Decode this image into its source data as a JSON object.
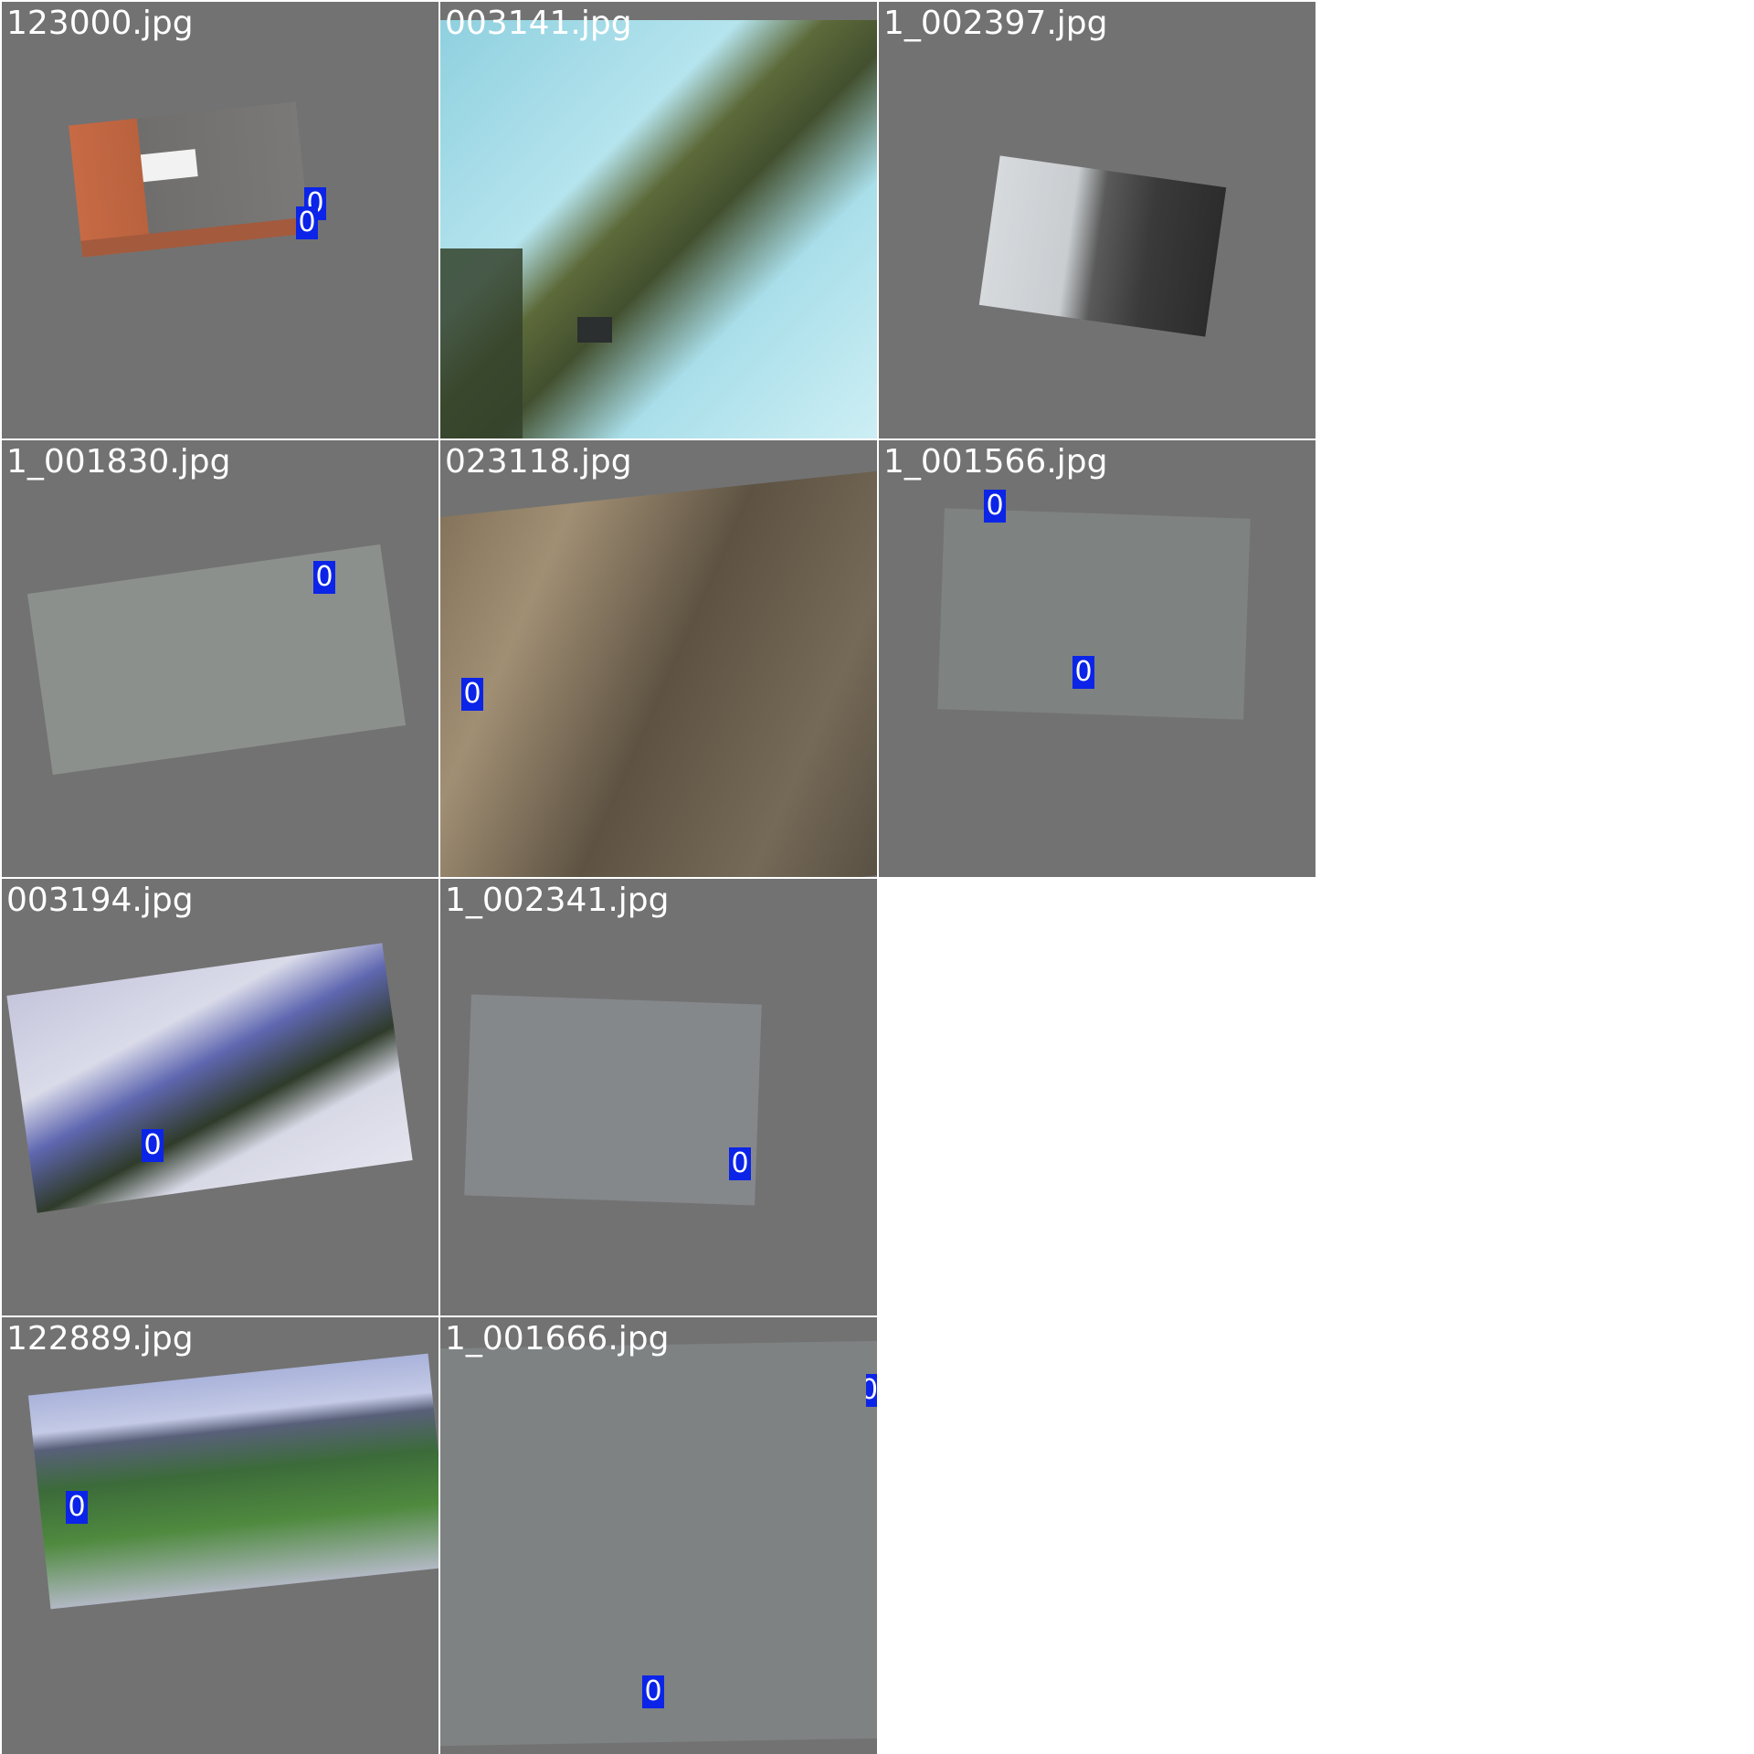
{
  "mosaic": {
    "tiles": [
      {
        "filename": "123000.jpg"
      },
      {
        "filename": "003141.jpg"
      },
      {
        "filename": "1_002397.jpg"
      },
      {
        "filename": "1_001830.jpg"
      },
      {
        "filename": "023118.jpg"
      },
      {
        "filename": "1_001566.jpg"
      },
      {
        "filename": "003194.jpg"
      },
      {
        "filename": "1_002341.jpg"
      },
      {
        "filename": "122889.jpg"
      },
      {
        "filename": "1_001666.jpg"
      }
    ],
    "class_label": "0",
    "colors": {
      "tile_background": "#727272",
      "label_box": "#0b24e8",
      "label_text": "#ffffff",
      "page_background": "#ffffff"
    }
  }
}
